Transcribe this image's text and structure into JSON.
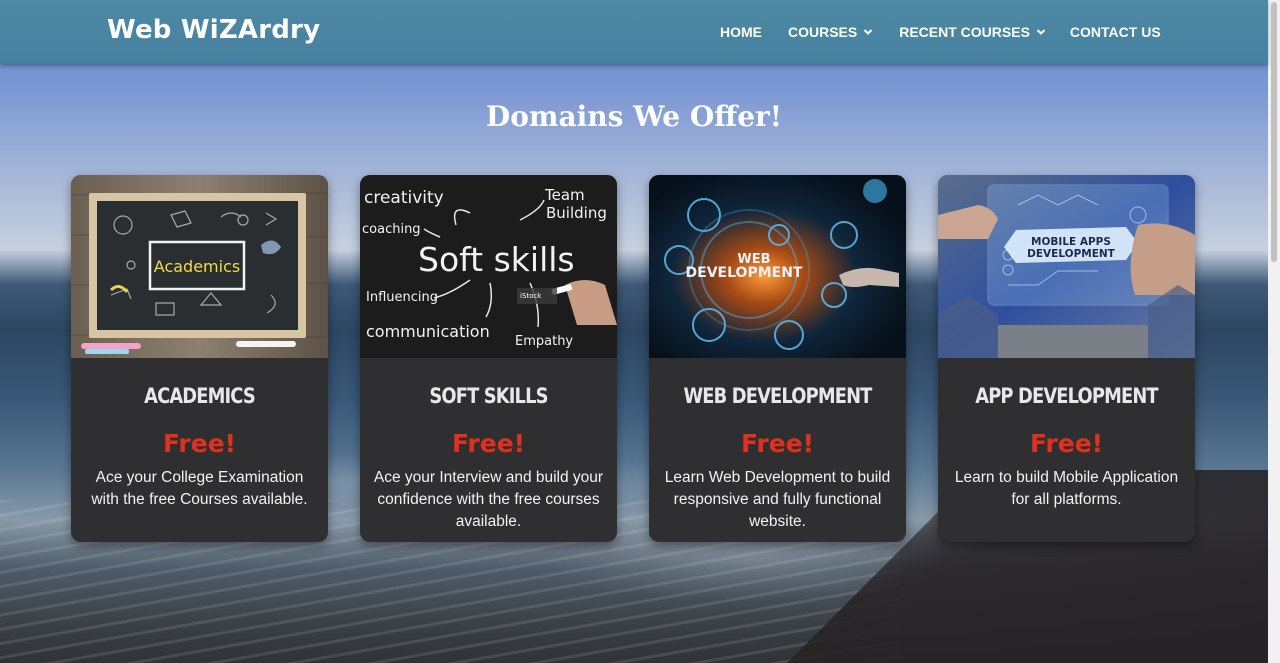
{
  "navbar": {
    "brand": "Web WiZArdry",
    "links": [
      {
        "label": "HOME",
        "dropdown": false
      },
      {
        "label": "COURSES",
        "dropdown": true
      },
      {
        "label": "RECENT COURSES",
        "dropdown": true
      },
      {
        "label": "CONTACT US",
        "dropdown": false
      }
    ]
  },
  "main": {
    "title": "Domains We Offer!",
    "cards": [
      {
        "image_text": "Academics",
        "title": "ACADEMICS",
        "price": "Free!",
        "description": "Ace your College Examination with the free Courses available."
      },
      {
        "image_text": "Soft Skills",
        "image_words": [
          "creativity",
          "Team Building",
          "coaching",
          "Influencing",
          "communication",
          "Empathy"
        ],
        "title": "SOFT SKILLS",
        "price": "Free!",
        "description": "Ace your Interview and build your confidence with the free courses available."
      },
      {
        "image_text": "WEB DEVELOPMENT",
        "title": "WEB DEVELOPMENT",
        "price": "Free!",
        "description": "Learn Web Development to build responsive and fully functional website."
      },
      {
        "image_text": "MOBILE APPS DEVELOPMENT",
        "title": "APP DEVELOPMENT",
        "price": "Free!",
        "description": "Learn to build Mobile Application for all platforms."
      }
    ]
  },
  "colors": {
    "navbar": "#4883a1",
    "card_bg": "#2f2f32",
    "price": "#e0301e",
    "text": "#ffffff"
  },
  "icons": [
    "chevron-down-icon"
  ]
}
